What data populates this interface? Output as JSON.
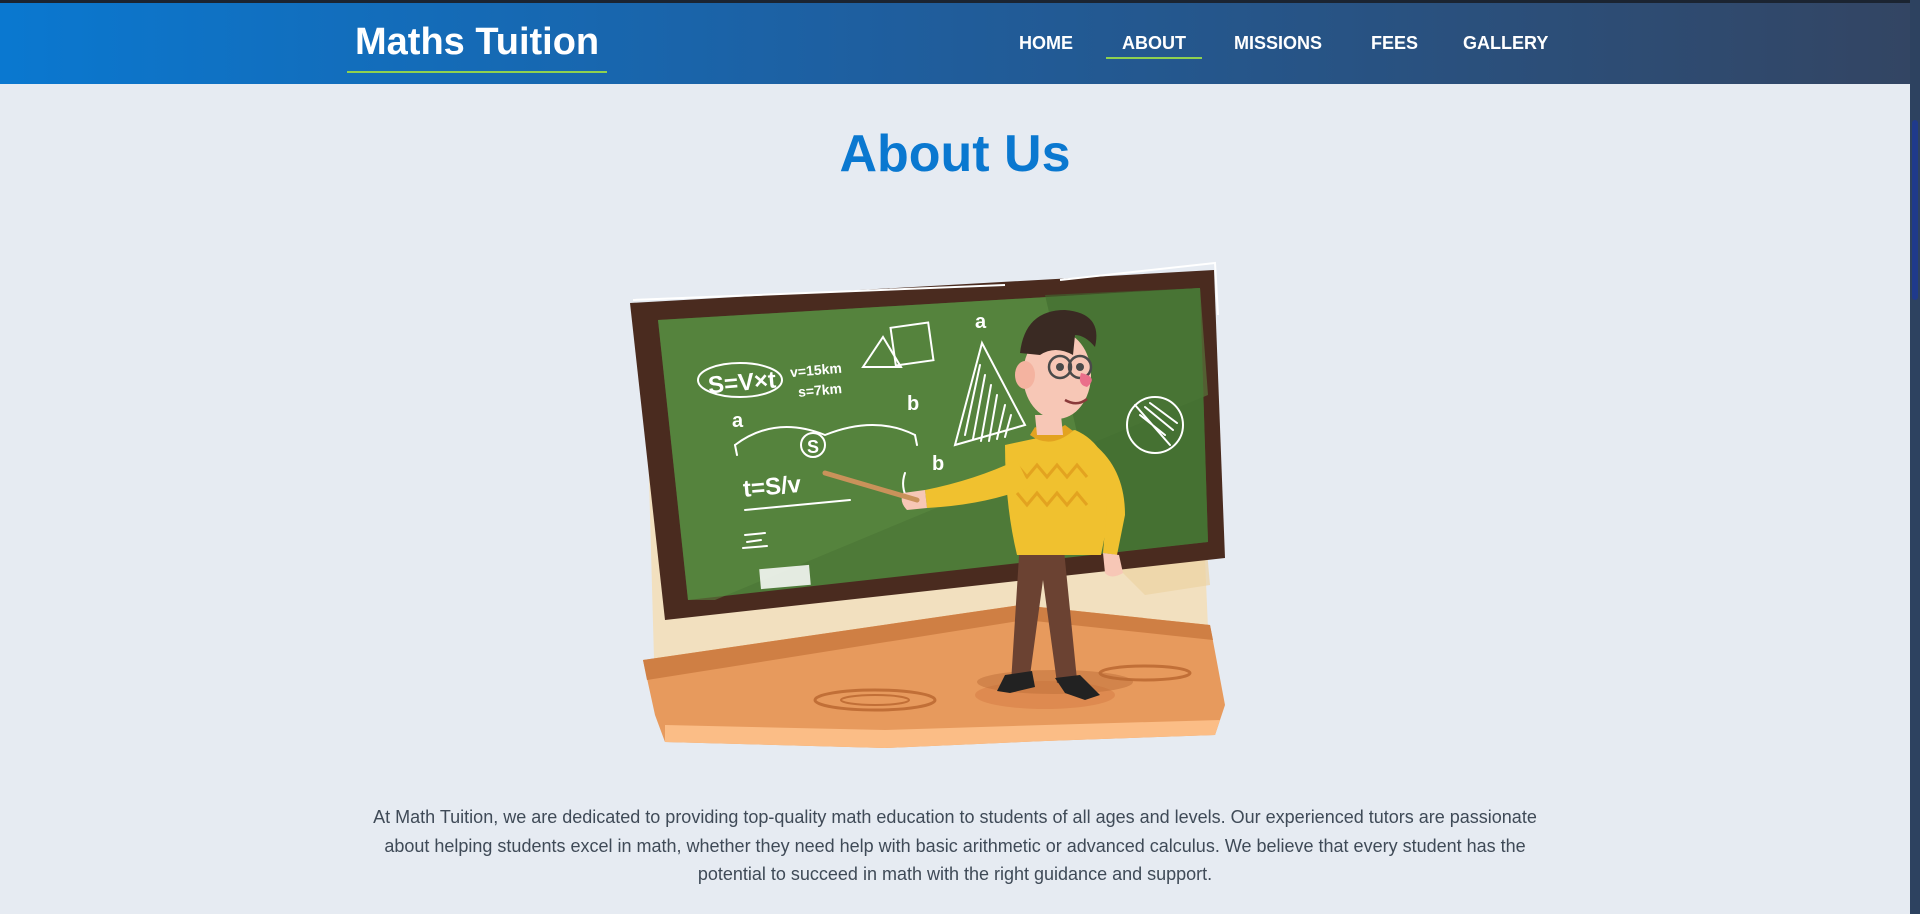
{
  "header": {
    "brand": "Maths Tuition",
    "nav": [
      {
        "label": "HOME",
        "active": false
      },
      {
        "label": "ABOUT",
        "active": true
      },
      {
        "label": "MISSIONS",
        "active": false
      },
      {
        "label": "FEES",
        "active": false
      },
      {
        "label": "GALLERY",
        "active": false
      }
    ]
  },
  "main": {
    "title": "About Us",
    "illustration": {
      "icon": "teacher-at-chalkboard-illustration",
      "board_formulas": {
        "f1": "S=V×t",
        "f2": "v=15km",
        "f3": "s=7km",
        "f4": "t=S/v",
        "a1": "a",
        "a2": "a",
        "b1": "b",
        "b2": "b",
        "s": "S"
      }
    },
    "paragraph": "At Math Tuition, we are dedicated to providing top-quality math education to students of all ages and levels. Our experienced tutors are passionate about helping students excel in math, whether they need help with basic arithmetic or advanced calculus. We believe that every student has the potential to succeed in math with the right guidance and support."
  },
  "colors": {
    "accent": "#0a78d0",
    "underline": "#8fd14f",
    "page_bg": "#e6ebf2",
    "nav_start": "#0a78d0",
    "nav_end": "#334563"
  }
}
